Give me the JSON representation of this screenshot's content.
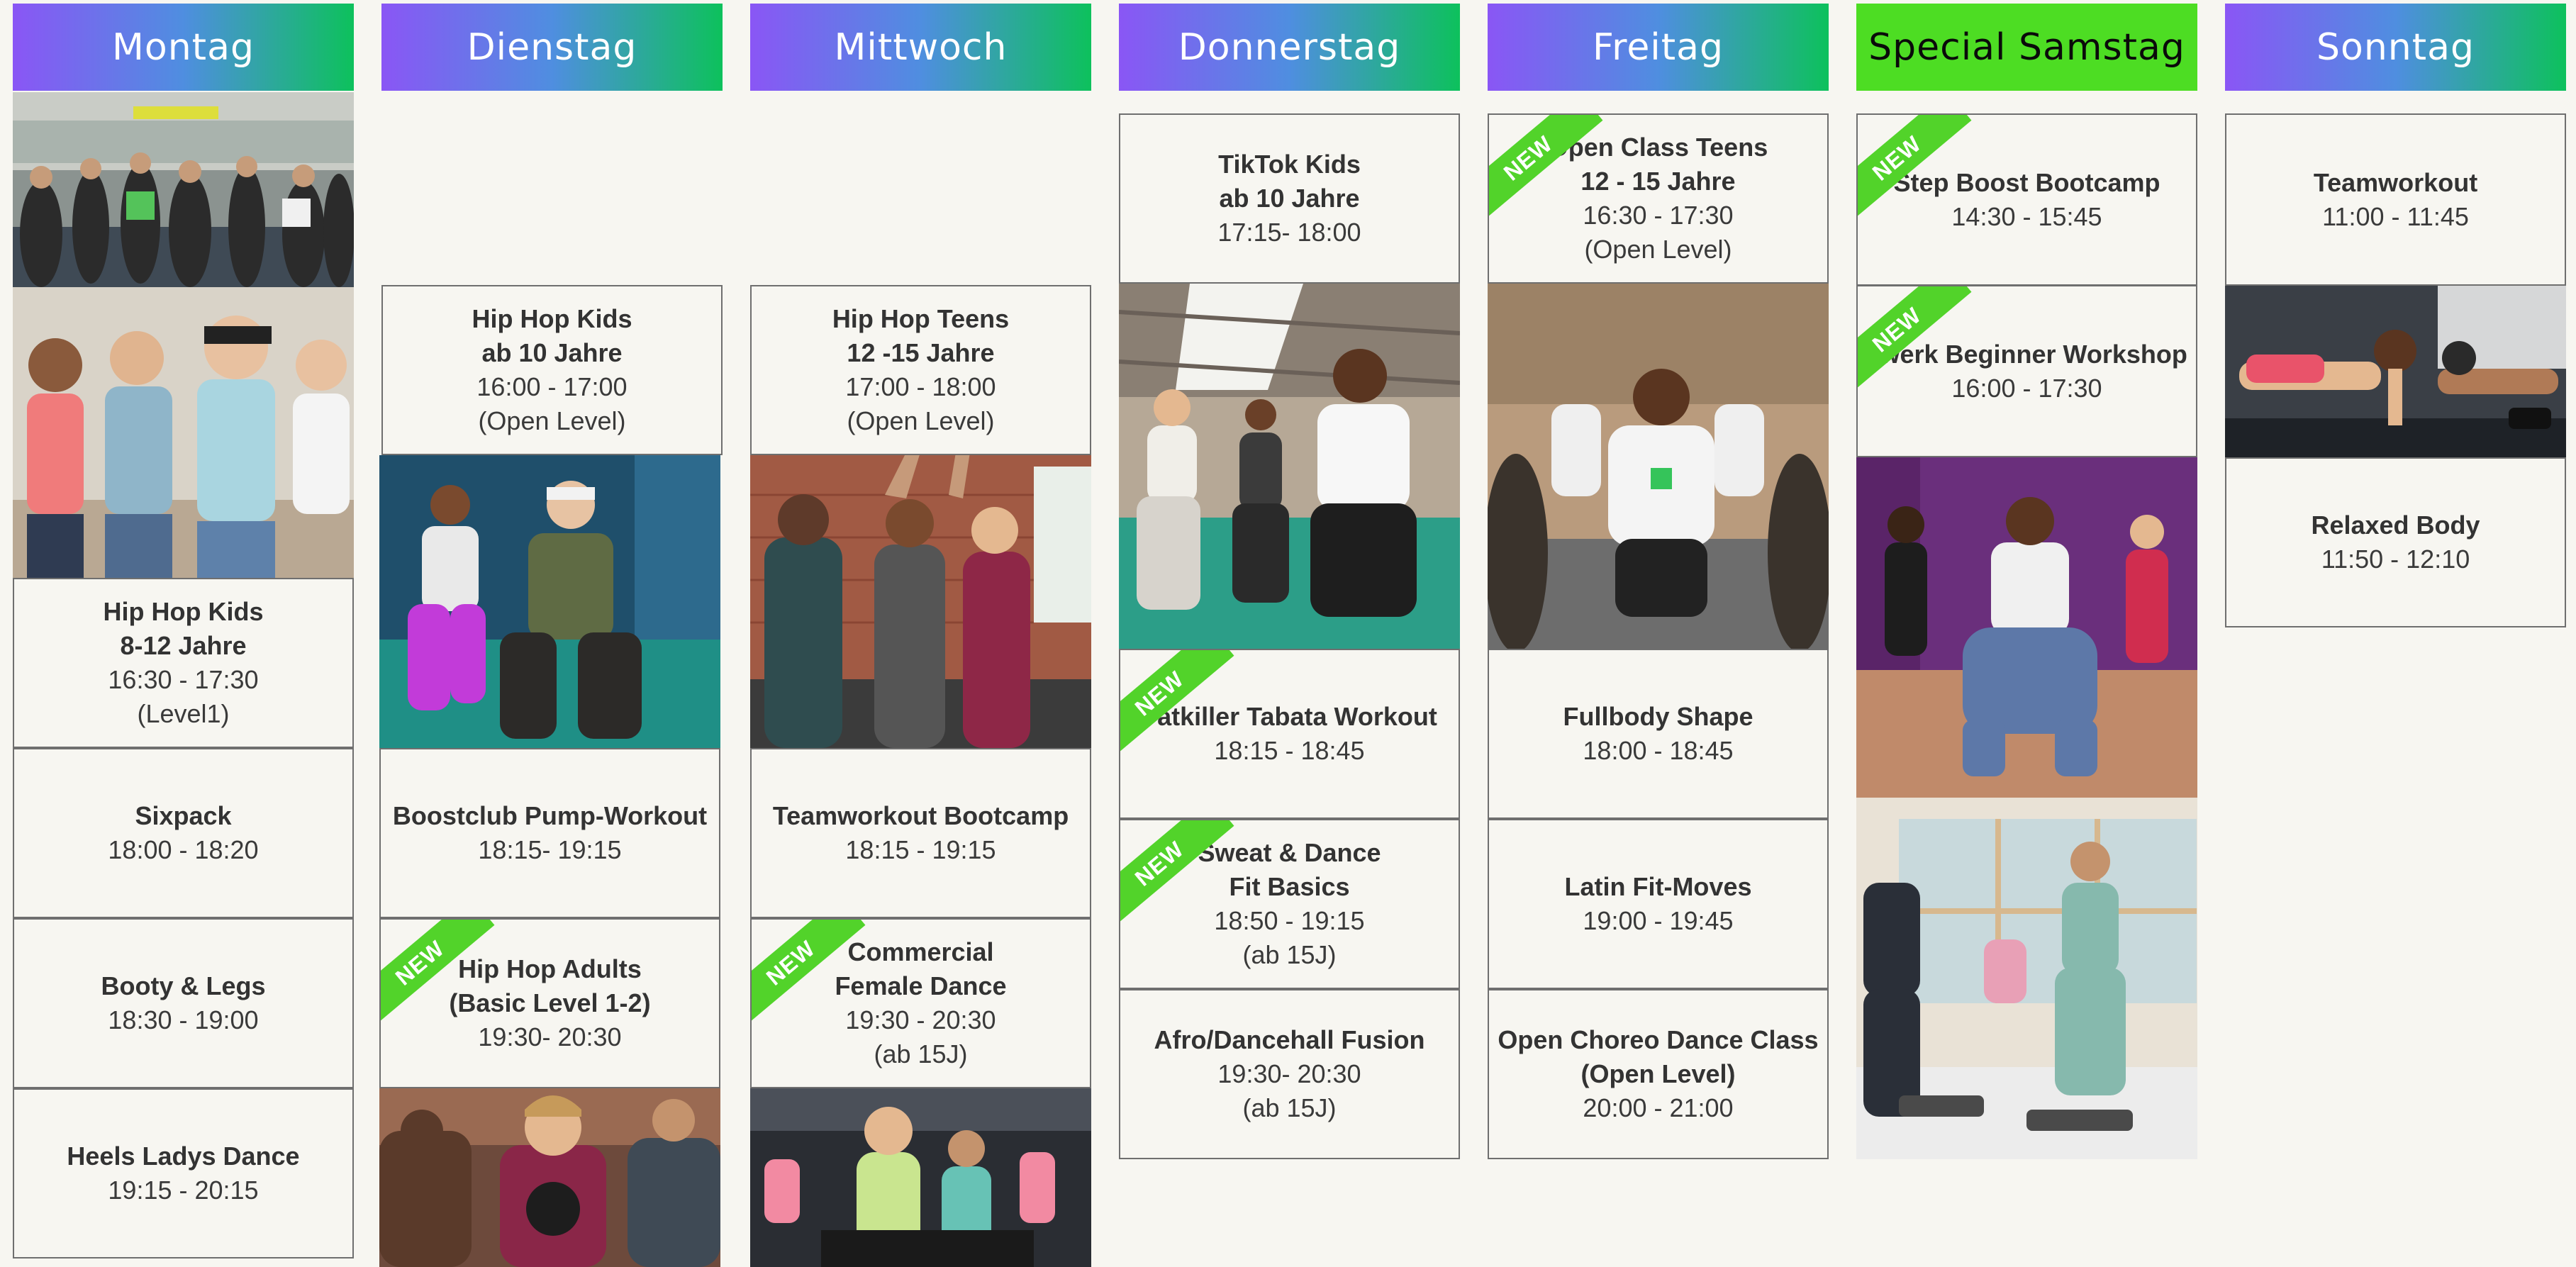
{
  "days": [
    {
      "label": "Montag",
      "header_color": "gradient"
    },
    {
      "label": "Dienstag",
      "header_color": "gradient"
    },
    {
      "label": "Mittwoch",
      "header_color": "gradient"
    },
    {
      "label": "Donnerstag",
      "header_color": "gradient"
    },
    {
      "label": "Freitag",
      "header_color": "gradient"
    },
    {
      "label": "Special Samstag",
      "header_color": "#4ddd23"
    },
    {
      "label": "Sonntag",
      "header_color": "gradient"
    }
  ],
  "badge_text": "NEW",
  "classes": {
    "mon": [
      {
        "lines": [
          "Hip Hop Kids",
          "8-12 Jahre"
        ],
        "sub": [
          "16:30 - 17:30",
          "(Level1)"
        ]
      },
      {
        "lines": [
          "Sixpack"
        ],
        "sub": [
          "18:00 - 18:20"
        ]
      },
      {
        "lines": [
          "Booty & Legs"
        ],
        "sub": [
          "18:30 - 19:00"
        ]
      },
      {
        "lines": [
          "Heels Ladys Dance"
        ],
        "sub": [
          "19:15 - 20:15"
        ]
      }
    ],
    "tue": [
      {
        "lines": [
          "Hip Hop Kids",
          "ab 10 Jahre"
        ],
        "sub": [
          "16:00 - 17:00",
          "(Open Level)"
        ]
      },
      {
        "lines": [
          "Boostclub Pump-Workout"
        ],
        "sub": [
          "18:15- 19:15"
        ]
      },
      {
        "lines": [
          "Hip Hop Adults",
          "(Basic Level 1-2)"
        ],
        "sub": [
          "19:30- 20:30"
        ],
        "new": true
      }
    ],
    "wed": [
      {
        "lines": [
          "Hip Hop Teens",
          "12 -15 Jahre"
        ],
        "sub": [
          "17:00 - 18:00",
          "(Open Level)"
        ]
      },
      {
        "lines": [
          "Teamworkout Bootcamp"
        ],
        "sub": [
          "18:15 - 19:15"
        ]
      },
      {
        "lines": [
          "Commercial",
          "Female Dance"
        ],
        "sub": [
          "19:30 - 20:30",
          "(ab 15J)"
        ],
        "new": true
      }
    ],
    "thu": [
      {
        "lines": [
          "TikTok Kids",
          "ab 10 Jahre"
        ],
        "sub": [
          "17:15- 18:00"
        ]
      },
      {
        "lines": [
          "Fatkiller Tabata Workout"
        ],
        "sub": [
          "18:15 - 18:45"
        ],
        "new": true
      },
      {
        "lines": [
          "Sweat & Dance",
          "Fit Basics"
        ],
        "sub": [
          "18:50 - 19:15",
          "(ab 15J)"
        ],
        "new": true
      },
      {
        "lines": [
          "Afro/Dancehall Fusion"
        ],
        "sub": [
          "19:30- 20:30",
          "(ab 15J)"
        ]
      }
    ],
    "fri": [
      {
        "lines": [
          "Open Class Teens",
          "12 - 15 Jahre"
        ],
        "sub": [
          "16:30 - 17:30",
          "(Open Level)"
        ],
        "new": true
      },
      {
        "lines": [
          "Fullbody Shape"
        ],
        "sub": [
          "18:00 - 18:45"
        ]
      },
      {
        "lines": [
          "Latin Fit-Moves"
        ],
        "sub": [
          "19:00 - 19:45"
        ]
      },
      {
        "lines": [
          "Open Choreo Dance Class",
          "(Open Level)"
        ],
        "sub": [
          "20:00 - 21:00"
        ]
      }
    ],
    "sat": [
      {
        "lines": [
          "Step Boost Bootcamp"
        ],
        "sub": [
          "14:30 - 15:45"
        ],
        "new": true
      },
      {
        "lines": [
          "Twerk Beginner Workshop"
        ],
        "sub": [
          "16:00 - 17:30"
        ],
        "new": true
      }
    ],
    "sun": [
      {
        "lines": [
          "Teamworkout"
        ],
        "sub": [
          "11:00 - 11:45"
        ]
      },
      {
        "lines": [
          "Relaxed Body"
        ],
        "sub": [
          "11:50 - 12:10"
        ]
      }
    ]
  }
}
